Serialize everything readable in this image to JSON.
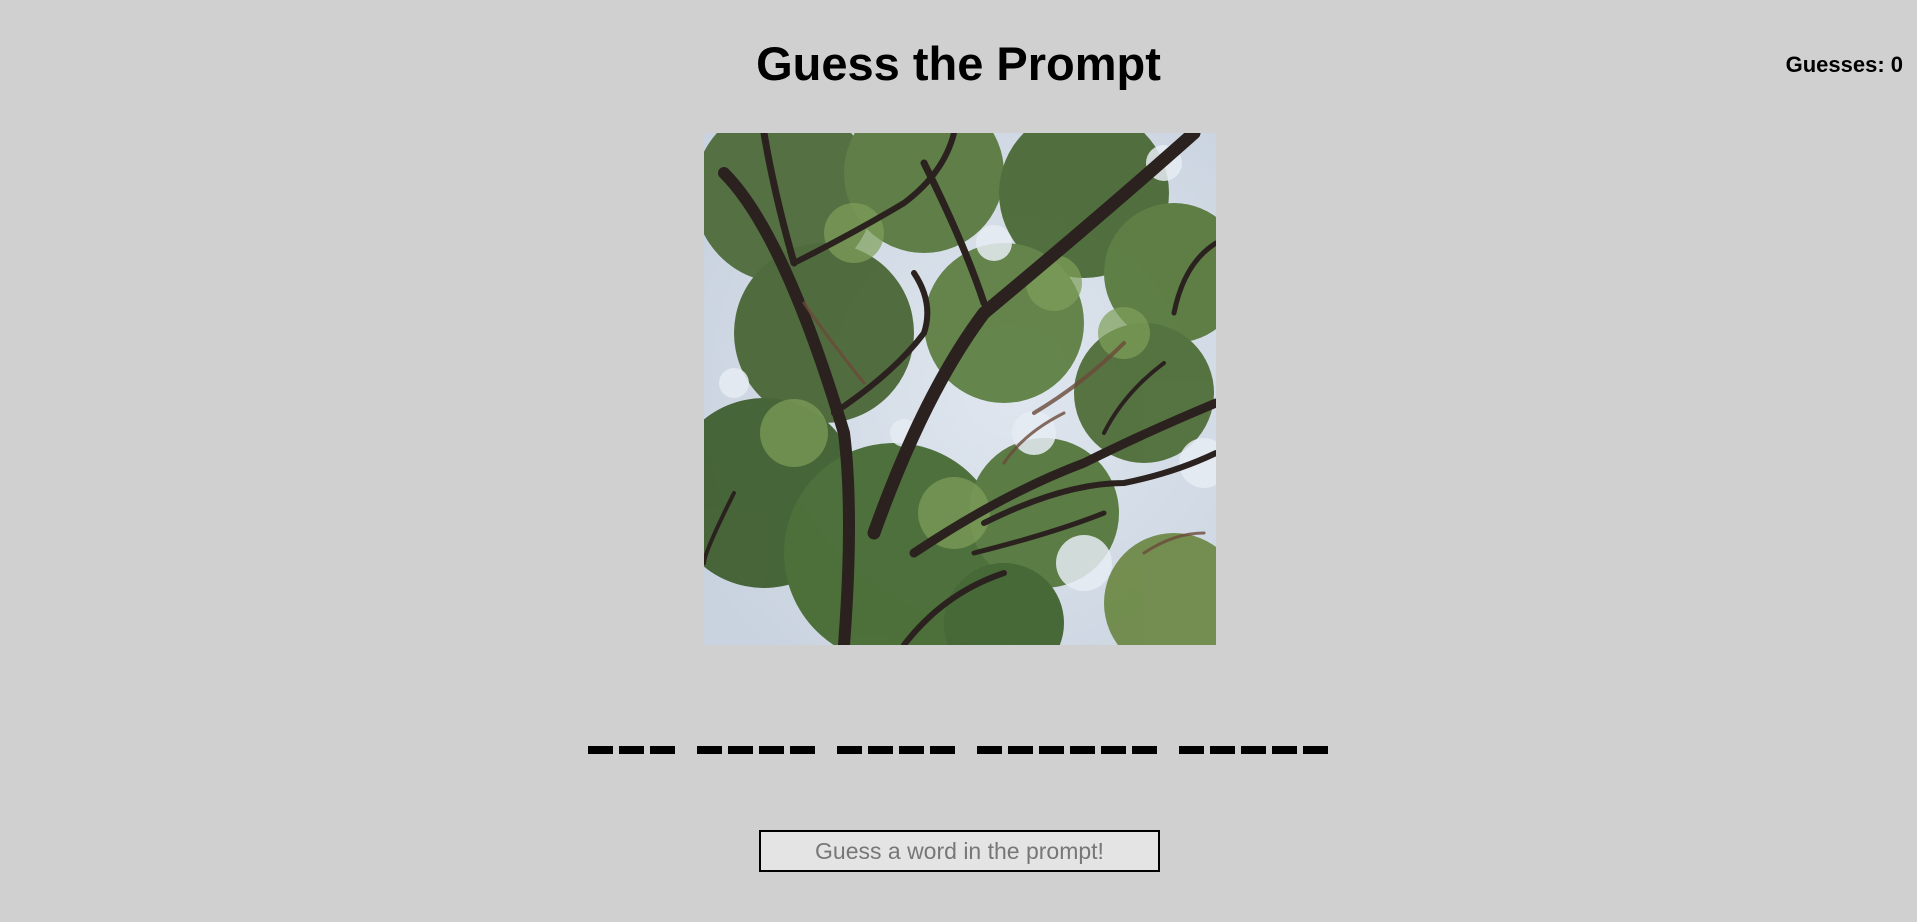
{
  "header": {
    "title": "Guess the Prompt",
    "guess_counter": "Guesses: 0"
  },
  "image": {
    "description_icon": "generated-tree-canopy-image"
  },
  "prompt_blanks": {
    "word_lengths": [
      3,
      4,
      4,
      6,
      5
    ]
  },
  "guess": {
    "placeholder": "Guess a word in the prompt!",
    "value": ""
  },
  "colors": {
    "background": "#d0d0d0",
    "text": "#000000",
    "input_background": "#e4e4e4"
  }
}
